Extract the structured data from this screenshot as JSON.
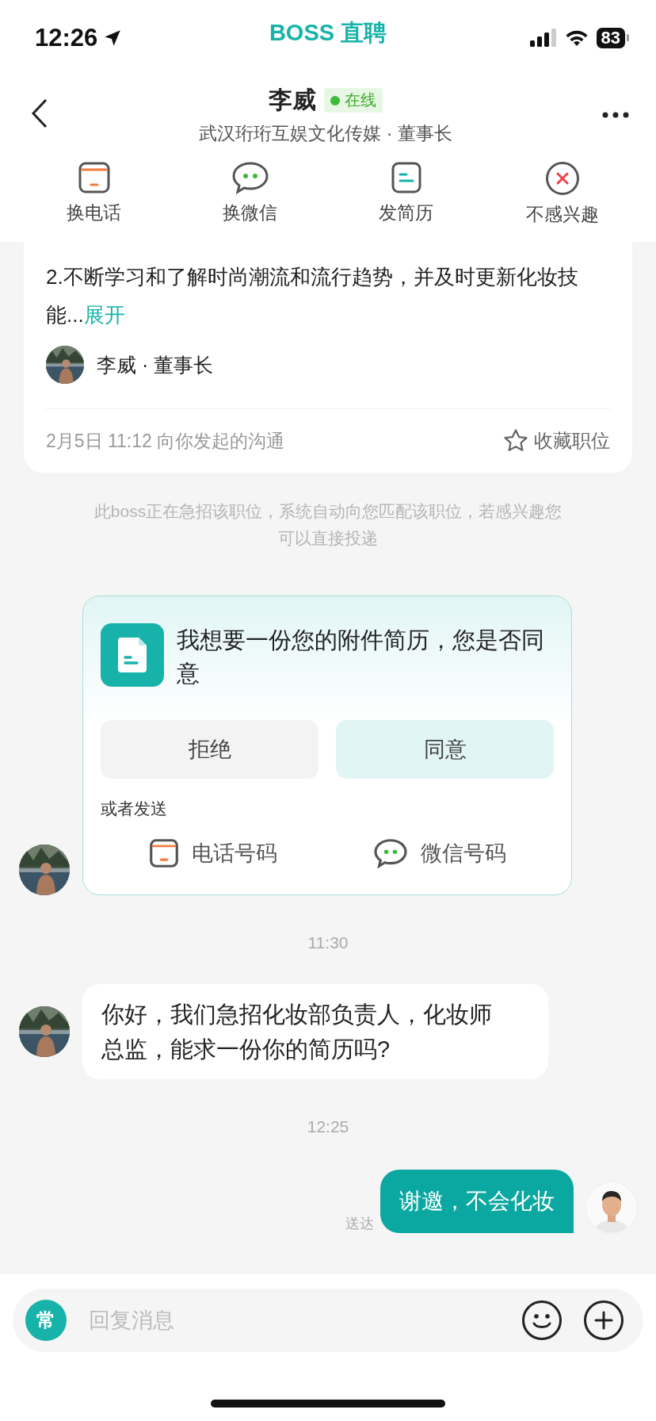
{
  "status_bar": {
    "time": "12:26",
    "app_label": "BOSS 直聘",
    "battery": "83"
  },
  "header": {
    "name": "李威",
    "status": "在线",
    "subtitle": "武汉珩珩互娱文化传媒 · 董事长"
  },
  "actions": [
    {
      "label": "换电话",
      "kind": "phone"
    },
    {
      "label": "换微信",
      "kind": "wechat"
    },
    {
      "label": "发简历",
      "kind": "resume"
    },
    {
      "label": "不感兴趣",
      "kind": "uninterested"
    }
  ],
  "job_card": {
    "description": "2.不断学习和了解时尚潮流和流行趋势，并及时更新化妆技能...",
    "expand": "展开",
    "recruiter": "李威 · 董事长",
    "time": "2月5日 11:12 向你发起的沟通",
    "favorite": "收藏职位"
  },
  "notice": "此boss正在急招该职位，系统自动向您匹配该职位，若感兴趣您可以直接投递",
  "messages": [
    {
      "kind": "request",
      "text": "我想要一份您的附件简历，您是否同意",
      "buttons": [
        {
          "label": "拒绝",
          "kind": "decline"
        },
        {
          "label": "同意",
          "kind": "accept"
        }
      ],
      "alt_label": "或者发送",
      "options": [
        {
          "label": "电话号码",
          "kind": "phone"
        },
        {
          "label": "微信号码",
          "kind": "wechat"
        }
      ]
    },
    {
      "kind": "time",
      "text": "11:30"
    },
    {
      "kind": "received",
      "text": "你好，我们急招化妆部负责人，化妆师总监，能求一份你的简历吗?"
    },
    {
      "kind": "time",
      "text": "12:25"
    },
    {
      "kind": "sent",
      "text": "谢邀，不会化妆",
      "status": "送达"
    }
  ],
  "input": {
    "shortcut": "常",
    "placeholder": "回复消息"
  }
}
